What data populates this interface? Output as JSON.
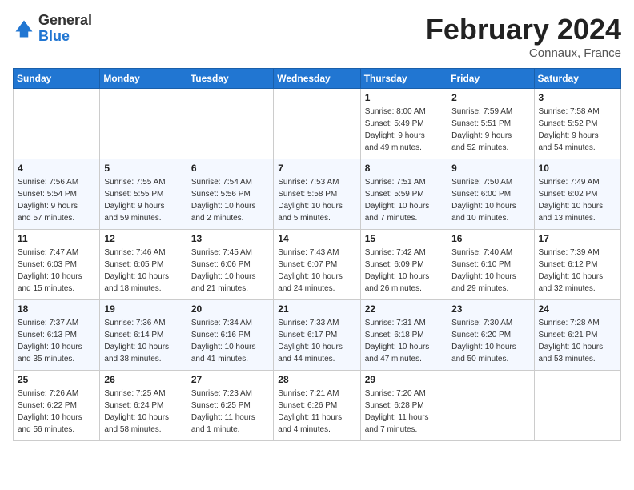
{
  "header": {
    "logo_general": "General",
    "logo_blue": "Blue",
    "title": "February 2024",
    "location": "Connaux, France"
  },
  "days_of_week": [
    "Sunday",
    "Monday",
    "Tuesday",
    "Wednesday",
    "Thursday",
    "Friday",
    "Saturday"
  ],
  "weeks": [
    [
      {
        "day": "",
        "info": ""
      },
      {
        "day": "",
        "info": ""
      },
      {
        "day": "",
        "info": ""
      },
      {
        "day": "",
        "info": ""
      },
      {
        "day": "1",
        "info": "Sunrise: 8:00 AM\nSunset: 5:49 PM\nDaylight: 9 hours\nand 49 minutes."
      },
      {
        "day": "2",
        "info": "Sunrise: 7:59 AM\nSunset: 5:51 PM\nDaylight: 9 hours\nand 52 minutes."
      },
      {
        "day": "3",
        "info": "Sunrise: 7:58 AM\nSunset: 5:52 PM\nDaylight: 9 hours\nand 54 minutes."
      }
    ],
    [
      {
        "day": "4",
        "info": "Sunrise: 7:56 AM\nSunset: 5:54 PM\nDaylight: 9 hours\nand 57 minutes."
      },
      {
        "day": "5",
        "info": "Sunrise: 7:55 AM\nSunset: 5:55 PM\nDaylight: 9 hours\nand 59 minutes."
      },
      {
        "day": "6",
        "info": "Sunrise: 7:54 AM\nSunset: 5:56 PM\nDaylight: 10 hours\nand 2 minutes."
      },
      {
        "day": "7",
        "info": "Sunrise: 7:53 AM\nSunset: 5:58 PM\nDaylight: 10 hours\nand 5 minutes."
      },
      {
        "day": "8",
        "info": "Sunrise: 7:51 AM\nSunset: 5:59 PM\nDaylight: 10 hours\nand 7 minutes."
      },
      {
        "day": "9",
        "info": "Sunrise: 7:50 AM\nSunset: 6:00 PM\nDaylight: 10 hours\nand 10 minutes."
      },
      {
        "day": "10",
        "info": "Sunrise: 7:49 AM\nSunset: 6:02 PM\nDaylight: 10 hours\nand 13 minutes."
      }
    ],
    [
      {
        "day": "11",
        "info": "Sunrise: 7:47 AM\nSunset: 6:03 PM\nDaylight: 10 hours\nand 15 minutes."
      },
      {
        "day": "12",
        "info": "Sunrise: 7:46 AM\nSunset: 6:05 PM\nDaylight: 10 hours\nand 18 minutes."
      },
      {
        "day": "13",
        "info": "Sunrise: 7:45 AM\nSunset: 6:06 PM\nDaylight: 10 hours\nand 21 minutes."
      },
      {
        "day": "14",
        "info": "Sunrise: 7:43 AM\nSunset: 6:07 PM\nDaylight: 10 hours\nand 24 minutes."
      },
      {
        "day": "15",
        "info": "Sunrise: 7:42 AM\nSunset: 6:09 PM\nDaylight: 10 hours\nand 26 minutes."
      },
      {
        "day": "16",
        "info": "Sunrise: 7:40 AM\nSunset: 6:10 PM\nDaylight: 10 hours\nand 29 minutes."
      },
      {
        "day": "17",
        "info": "Sunrise: 7:39 AM\nSunset: 6:12 PM\nDaylight: 10 hours\nand 32 minutes."
      }
    ],
    [
      {
        "day": "18",
        "info": "Sunrise: 7:37 AM\nSunset: 6:13 PM\nDaylight: 10 hours\nand 35 minutes."
      },
      {
        "day": "19",
        "info": "Sunrise: 7:36 AM\nSunset: 6:14 PM\nDaylight: 10 hours\nand 38 minutes."
      },
      {
        "day": "20",
        "info": "Sunrise: 7:34 AM\nSunset: 6:16 PM\nDaylight: 10 hours\nand 41 minutes."
      },
      {
        "day": "21",
        "info": "Sunrise: 7:33 AM\nSunset: 6:17 PM\nDaylight: 10 hours\nand 44 minutes."
      },
      {
        "day": "22",
        "info": "Sunrise: 7:31 AM\nSunset: 6:18 PM\nDaylight: 10 hours\nand 47 minutes."
      },
      {
        "day": "23",
        "info": "Sunrise: 7:30 AM\nSunset: 6:20 PM\nDaylight: 10 hours\nand 50 minutes."
      },
      {
        "day": "24",
        "info": "Sunrise: 7:28 AM\nSunset: 6:21 PM\nDaylight: 10 hours\nand 53 minutes."
      }
    ],
    [
      {
        "day": "25",
        "info": "Sunrise: 7:26 AM\nSunset: 6:22 PM\nDaylight: 10 hours\nand 56 minutes."
      },
      {
        "day": "26",
        "info": "Sunrise: 7:25 AM\nSunset: 6:24 PM\nDaylight: 10 hours\nand 58 minutes."
      },
      {
        "day": "27",
        "info": "Sunrise: 7:23 AM\nSunset: 6:25 PM\nDaylight: 11 hours\nand 1 minute."
      },
      {
        "day": "28",
        "info": "Sunrise: 7:21 AM\nSunset: 6:26 PM\nDaylight: 11 hours\nand 4 minutes."
      },
      {
        "day": "29",
        "info": "Sunrise: 7:20 AM\nSunset: 6:28 PM\nDaylight: 11 hours\nand 7 minutes."
      },
      {
        "day": "",
        "info": ""
      },
      {
        "day": "",
        "info": ""
      }
    ]
  ]
}
